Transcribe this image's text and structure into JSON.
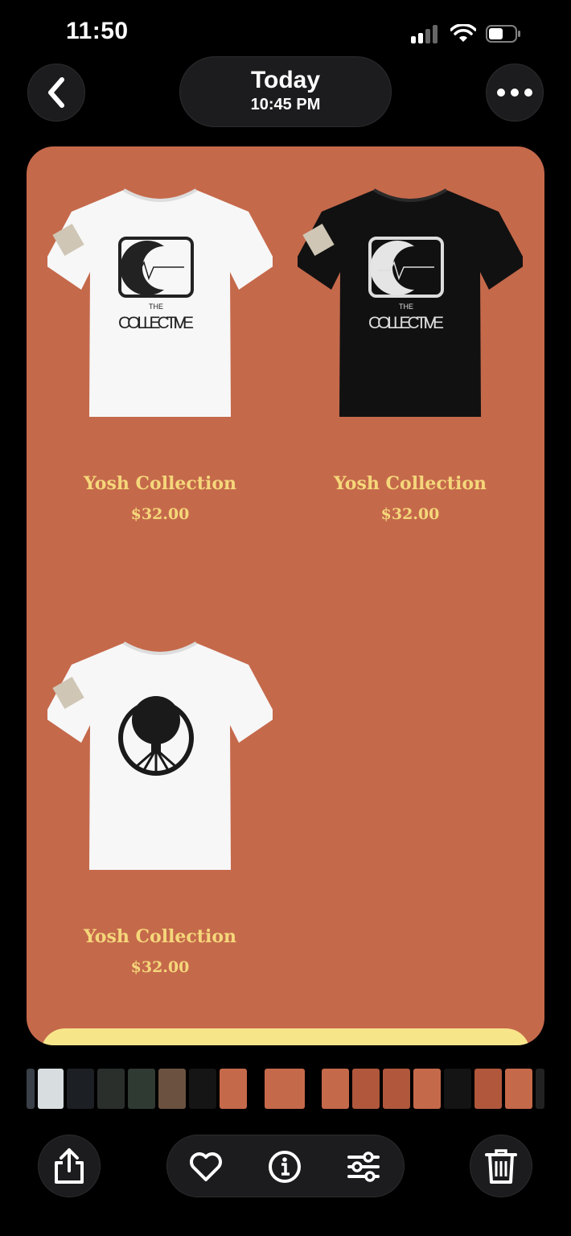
{
  "status_bar": {
    "time": "11:50"
  },
  "header": {
    "title": "Today",
    "subtitle": "10:45 PM"
  },
  "photo": {
    "background": "#c5694b",
    "products": [
      {
        "name": "Yosh Collection",
        "price": "$32.00",
        "shirt_color": "white",
        "graphic": "THE COLLECTIVE",
        "graphic_top": "THE",
        "graphic_bottom": "COLLECTIVE"
      },
      {
        "name": "Yosh Collection",
        "price": "$32.00",
        "shirt_color": "black",
        "graphic": "THE COLLECTIVE",
        "graphic_top": "THE",
        "graphic_bottom": "COLLECTIVE"
      },
      {
        "name": "Yosh Collection",
        "price": "$32.00",
        "shirt_color": "white",
        "graphic": "tree-of-life"
      }
    ]
  },
  "toolbar": {
    "icons": [
      "share-icon",
      "heart-icon",
      "info-icon",
      "adjust-icon",
      "trash-icon"
    ]
  },
  "colors": {
    "accent_text": "#f5d77a",
    "orange": "#c5694b",
    "yellow_bar": "#f7e58a"
  }
}
